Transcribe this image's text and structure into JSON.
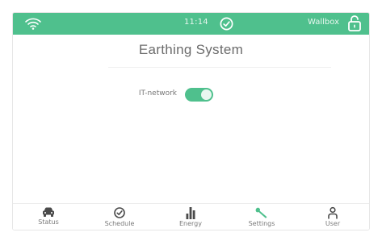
{
  "status_bar": {
    "time": "11:14",
    "device_name": "Wallbox",
    "accent_color": "#4fc08d"
  },
  "page": {
    "title": "Earthing System"
  },
  "settings": [
    {
      "label": "IT-network",
      "toggle_on": true
    }
  ],
  "tabs": [
    {
      "label": "Status",
      "icon": "car-icon",
      "active": false
    },
    {
      "label": "Schedule",
      "icon": "clock-icon",
      "active": false
    },
    {
      "label": "Energy",
      "icon": "bar-chart-icon",
      "active": false
    },
    {
      "label": "Settings",
      "icon": "wrench-icon",
      "active": true
    },
    {
      "label": "User",
      "icon": "user-icon",
      "active": false
    }
  ]
}
